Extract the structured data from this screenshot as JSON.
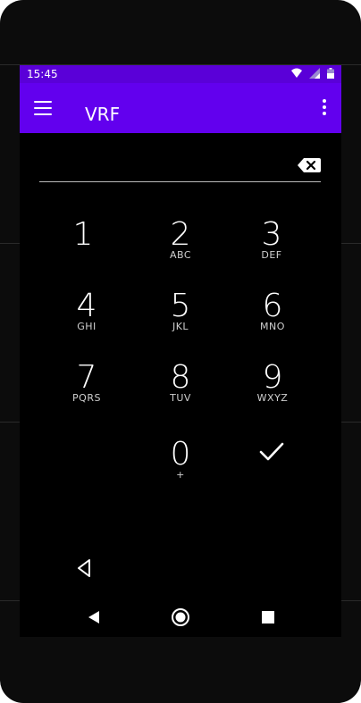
{
  "status": {
    "time": "15:45",
    "icons": [
      "wifi-icon",
      "signal-icon",
      "battery-icon"
    ]
  },
  "appbar": {
    "title": "VRF",
    "menu_icon": "hamburger-menu-icon",
    "overflow_icon": "more-vert-icon",
    "color": "#6200ee"
  },
  "input": {
    "value": "",
    "backspace_icon": "backspace-icon"
  },
  "keypad": {
    "keys": [
      {
        "digit": "1",
        "letters": ""
      },
      {
        "digit": "2",
        "letters": "ABC"
      },
      {
        "digit": "3",
        "letters": "DEF"
      },
      {
        "digit": "4",
        "letters": "GHI"
      },
      {
        "digit": "5",
        "letters": "JKL"
      },
      {
        "digit": "6",
        "letters": "MNO"
      },
      {
        "digit": "7",
        "letters": "PQRS"
      },
      {
        "digit": "8",
        "letters": "TUV"
      },
      {
        "digit": "9",
        "letters": "WXYZ"
      },
      {
        "digit": "0",
        "letters": "+"
      }
    ],
    "confirm_icon": "check-icon"
  },
  "navigation": {
    "back_icon": "back-arrow-icon",
    "home_icon": "home-icon",
    "recents_icon": "recents-icon"
  }
}
